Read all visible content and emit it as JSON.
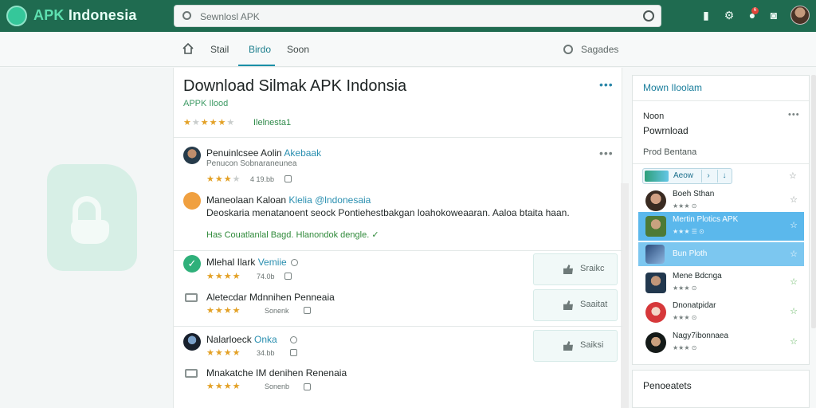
{
  "app": {
    "name_part1": "APK",
    "name_part2": "Indonesia"
  },
  "search": {
    "placeholder": "Sewnlosl APK"
  },
  "header_icons": [
    "bookmark-icon",
    "gear-icon",
    "notification-icon",
    "camera-icon"
  ],
  "notification_badge": "6",
  "tabs": {
    "start": "Stail",
    "active": "Birdo",
    "third": "Soon",
    "search_label": "Sagades"
  },
  "app_detail": {
    "title": "Download Silmak APK Indonsia",
    "subtitle": "APPK  Ilood",
    "rating_stars": 3,
    "rating_label": "Ilelnesta1"
  },
  "reviews": [
    {
      "name": "Penuinlcsee Aolin",
      "tag": "Akebaak",
      "sub": "Penucon Sobnaraneunea",
      "stars": 3,
      "meta": "4 19.bb"
    },
    {
      "name": "Maneolaan Kaloan",
      "tag": "Klelia @lndonesaia",
      "body": "Deoskaria menatanoent seock Pontiehestbakgan loahokoweaaran. Aaloa btaita haan.",
      "helpful": "Has Couatlanlal Bagd. Hlanondok dengle."
    },
    {
      "name": "Mlehal Ilark",
      "tag": "Vemiie",
      "stars": 3,
      "meta": "74.0b",
      "like": "Sraikc",
      "sub_title": "Aletecdar  Mdnnihen Penneaia",
      "sub_stars": 3,
      "sub_meta": "Sonenk",
      "sub_like": "Saaitat"
    },
    {
      "name": "Nalarloeck",
      "tag": "Onka",
      "stars": 3,
      "meta": "34.bb",
      "like": "Saiksi",
      "sub_title": "Mnakatche IM denihen Renenaia",
      "sub_stars": 3,
      "sub_meta": "Sonenb"
    }
  ],
  "sidebar": {
    "title": "Mown Iloolam",
    "label1": "Noon",
    "label2": "Powrnload",
    "label3": "Prod Bentana",
    "chip_label": "Aeow",
    "items": [
      {
        "name": "Boeh Sthan",
        "meta": "★★★  ⊙",
        "selected": "none"
      },
      {
        "name": "Mertin  Plotics APK",
        "meta": "★★★ ☰ ⊙",
        "selected": "sel"
      },
      {
        "name": "Bun Ploth",
        "meta": "",
        "selected": "sel2"
      },
      {
        "name": "Mene Bdcnga",
        "meta": "★★★  ⊙",
        "selected": "none"
      },
      {
        "name": "Dnonatpidar",
        "meta": "★★★  ⊙",
        "selected": "none"
      },
      {
        "name": "Nagy7ibonnaea",
        "meta": "★★★  ⊙",
        "selected": "none"
      }
    ],
    "footer_title": "Penoeatets"
  },
  "colors": {
    "brand": "#1f6b50",
    "accent": "#1a8fa6",
    "star": "#e3a126"
  }
}
